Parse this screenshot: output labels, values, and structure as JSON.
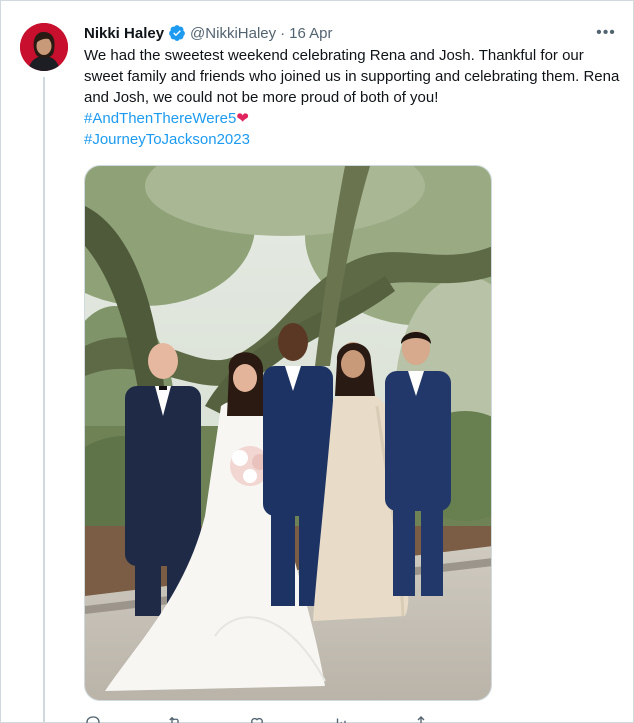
{
  "tweet": {
    "author_name": "Nikki Haley",
    "handle": "@NikkiHaley",
    "separator": "·",
    "date": "16 Apr",
    "text": "We had the sweetest weekend celebrating Rena and Josh. Thankful for our sweet family and friends who joined us in supporting and celebrating them. Rena and Josh, we could not be more proud of both of you!",
    "hashtag1": "#AndThenThereWere5",
    "hashtag1_emoji": "❤",
    "hashtag2": "#JourneyToJackson2023"
  },
  "icons": {
    "verified": "verified-badge-icon",
    "more": "more-options-icon",
    "reply": "reply-icon",
    "retweet": "retweet-icon",
    "like": "like-icon",
    "views": "views-icon",
    "share": "share-icon"
  },
  "colors": {
    "link": "#1d9bf0",
    "verified": "#1d9bf0",
    "heart": "#e0245e",
    "secondary_text": "#536471",
    "border": "#cfd9de"
  }
}
